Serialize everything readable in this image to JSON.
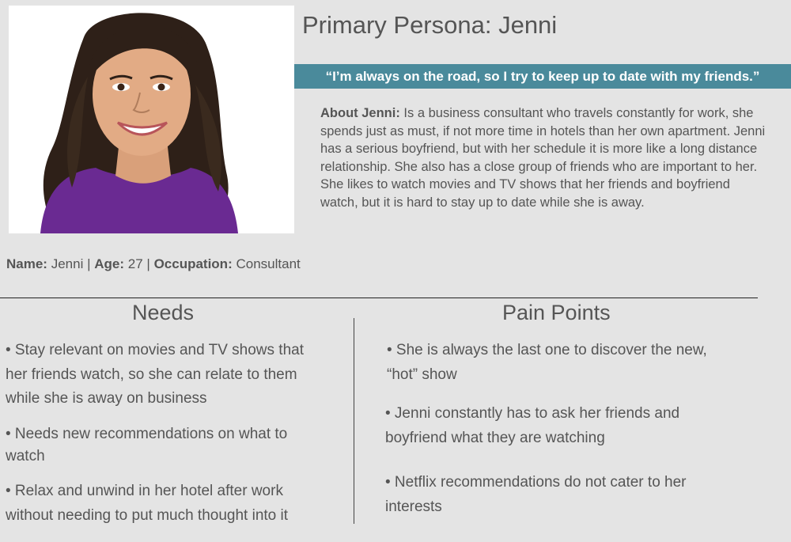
{
  "persona": {
    "title": "Primary Persona: Jenni",
    "quote": "“I’m always on the road, so I try to keep up to date with my friends.”",
    "about_label": "About Jenni:",
    "about_text": "Is a business consultant who travels constantly for work, she spends just as must, if not more time in hotels than her own apartment. Jenni has a serious boyfriend, but with her schedule it is more like a long distance relationship. She also has a close group of friends who are important to her. She likes to watch movies and TV shows that her friends and boyfriend watch, but it is hard to stay up to date while she is away.",
    "name_label": "Name:",
    "name_value": "Jenni",
    "sep1": "|",
    "age_label": "Age:",
    "age_value": "27",
    "sep2": "|",
    "occupation_label": "Occupation:",
    "occupation_value": "Consultant"
  },
  "needs": {
    "title": "Needs",
    "items": [
      "• Stay relevant on movies and TV shows that her friends watch, so she can relate to them while she is away on business",
      "• Needs new recommendations on what to watch",
      "• Relax and unwind in her hotel after work without needing to put much thought into it"
    ]
  },
  "pain_points": {
    "title": "Pain Points",
    "items": [
      "• She is always the last one to discover the new, “hot” show",
      "• Jenni constantly has to ask her friends and boyfriend what they are watching",
      "• Netflix recommendations do not cater to her interests"
    ]
  },
  "colors": {
    "background": "#e4e4e4",
    "banner": "#4a8a9b",
    "text": "#555555"
  }
}
